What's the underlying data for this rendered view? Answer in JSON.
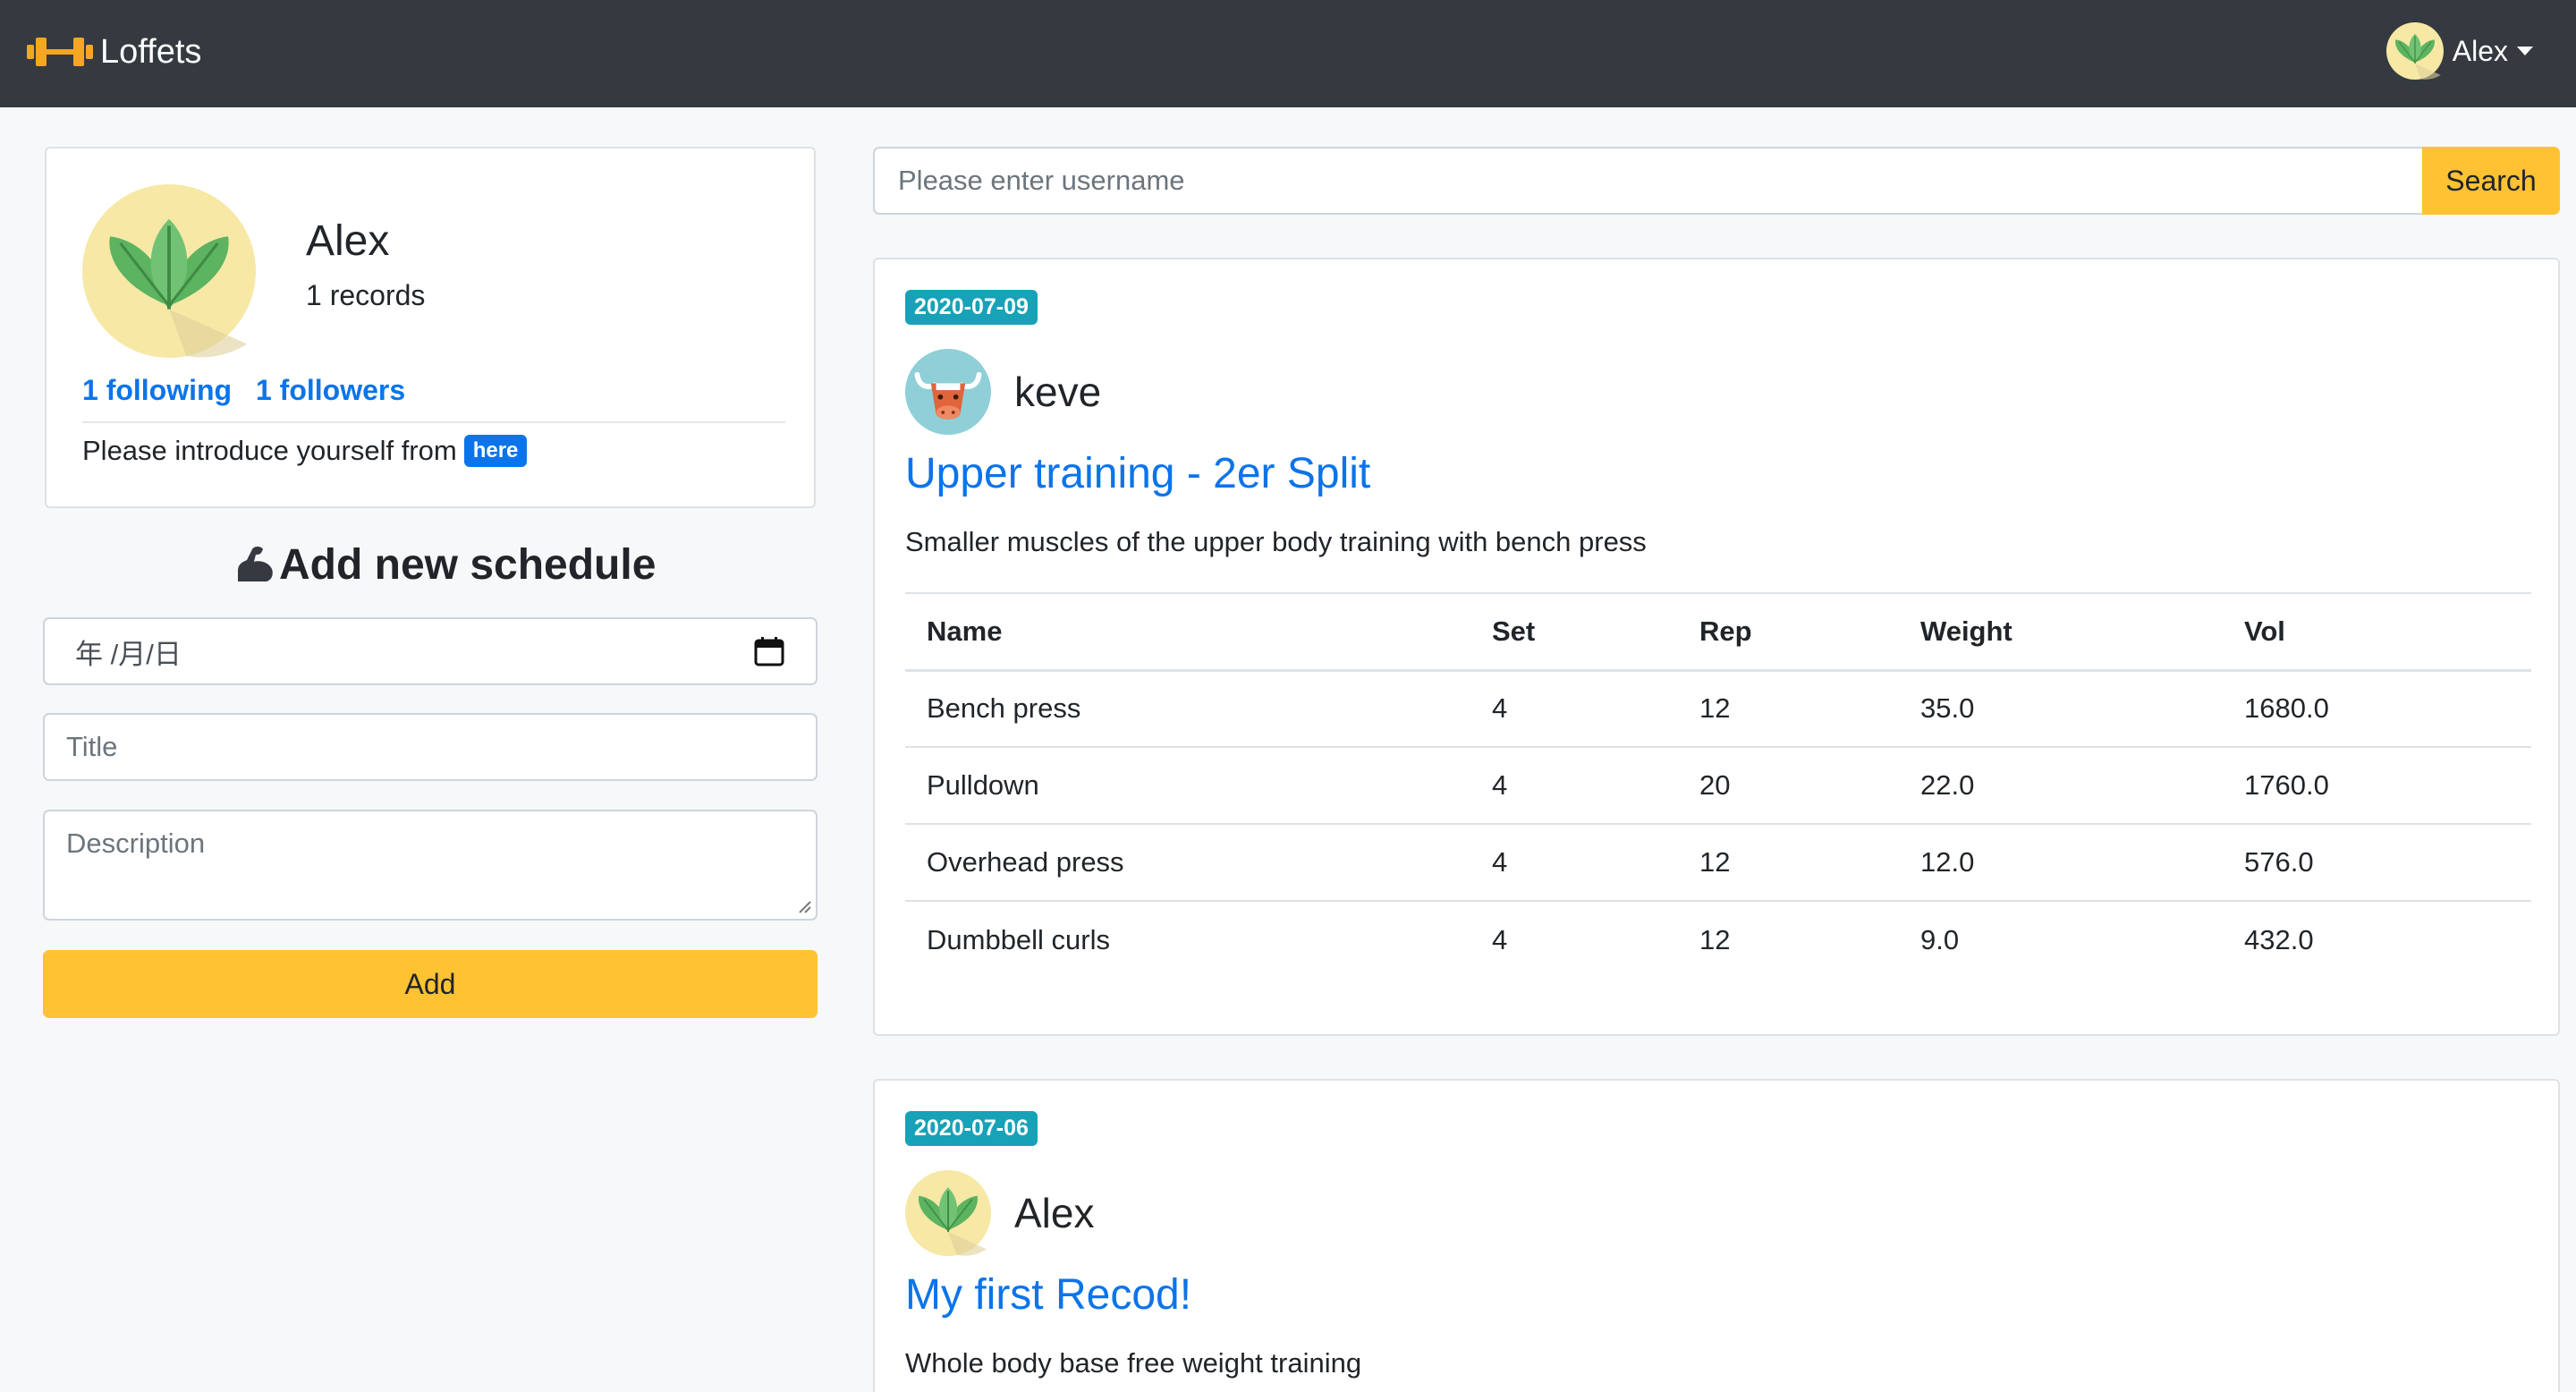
{
  "app": {
    "brand": "Loffets"
  },
  "navbar": {
    "user_name": "Alex"
  },
  "profile": {
    "name": "Alex",
    "records": "1 records",
    "following": "1 following",
    "followers": "1 followers",
    "intro_text": "Please introduce yourself from",
    "intro_link": "here"
  },
  "schedule_form": {
    "heading": "Add new schedule",
    "date_placeholder": "年 /月/日",
    "title_placeholder": "Title",
    "description_placeholder": "Description",
    "add_label": "Add"
  },
  "search": {
    "placeholder": "Please enter username",
    "button_label": "Search"
  },
  "records": [
    {
      "date": "2020-07-09",
      "author": "keve",
      "title": "Upper training - 2er Split",
      "description": "Smaller muscles of the upper body training with bench press",
      "columns": [
        "Name",
        "Set",
        "Rep",
        "Weight",
        "Vol"
      ],
      "rows": [
        [
          "Bench press",
          "4",
          "12",
          "35.0",
          "1680.0"
        ],
        [
          "Pulldown",
          "4",
          "20",
          "22.0",
          "1760.0"
        ],
        [
          "Overhead press",
          "4",
          "12",
          "12.0",
          "576.0"
        ],
        [
          "Dumbbell curls",
          "4",
          "12",
          "9.0",
          "432.0"
        ]
      ]
    },
    {
      "date": "2020-07-06",
      "author": "Alex",
      "title": "My first Recod!",
      "description": "Whole body base free weight training"
    }
  ],
  "colors": {
    "navbar": "#343a40",
    "accent": "#ffc232",
    "link": "#0b74ea",
    "date_badge": "#17a2b8"
  },
  "icons": [
    "dumbbell-icon",
    "leaf-avatar-icon",
    "bull-avatar-icon",
    "flexed-arm-icon",
    "calendar-icon",
    "caret-down-icon"
  ]
}
